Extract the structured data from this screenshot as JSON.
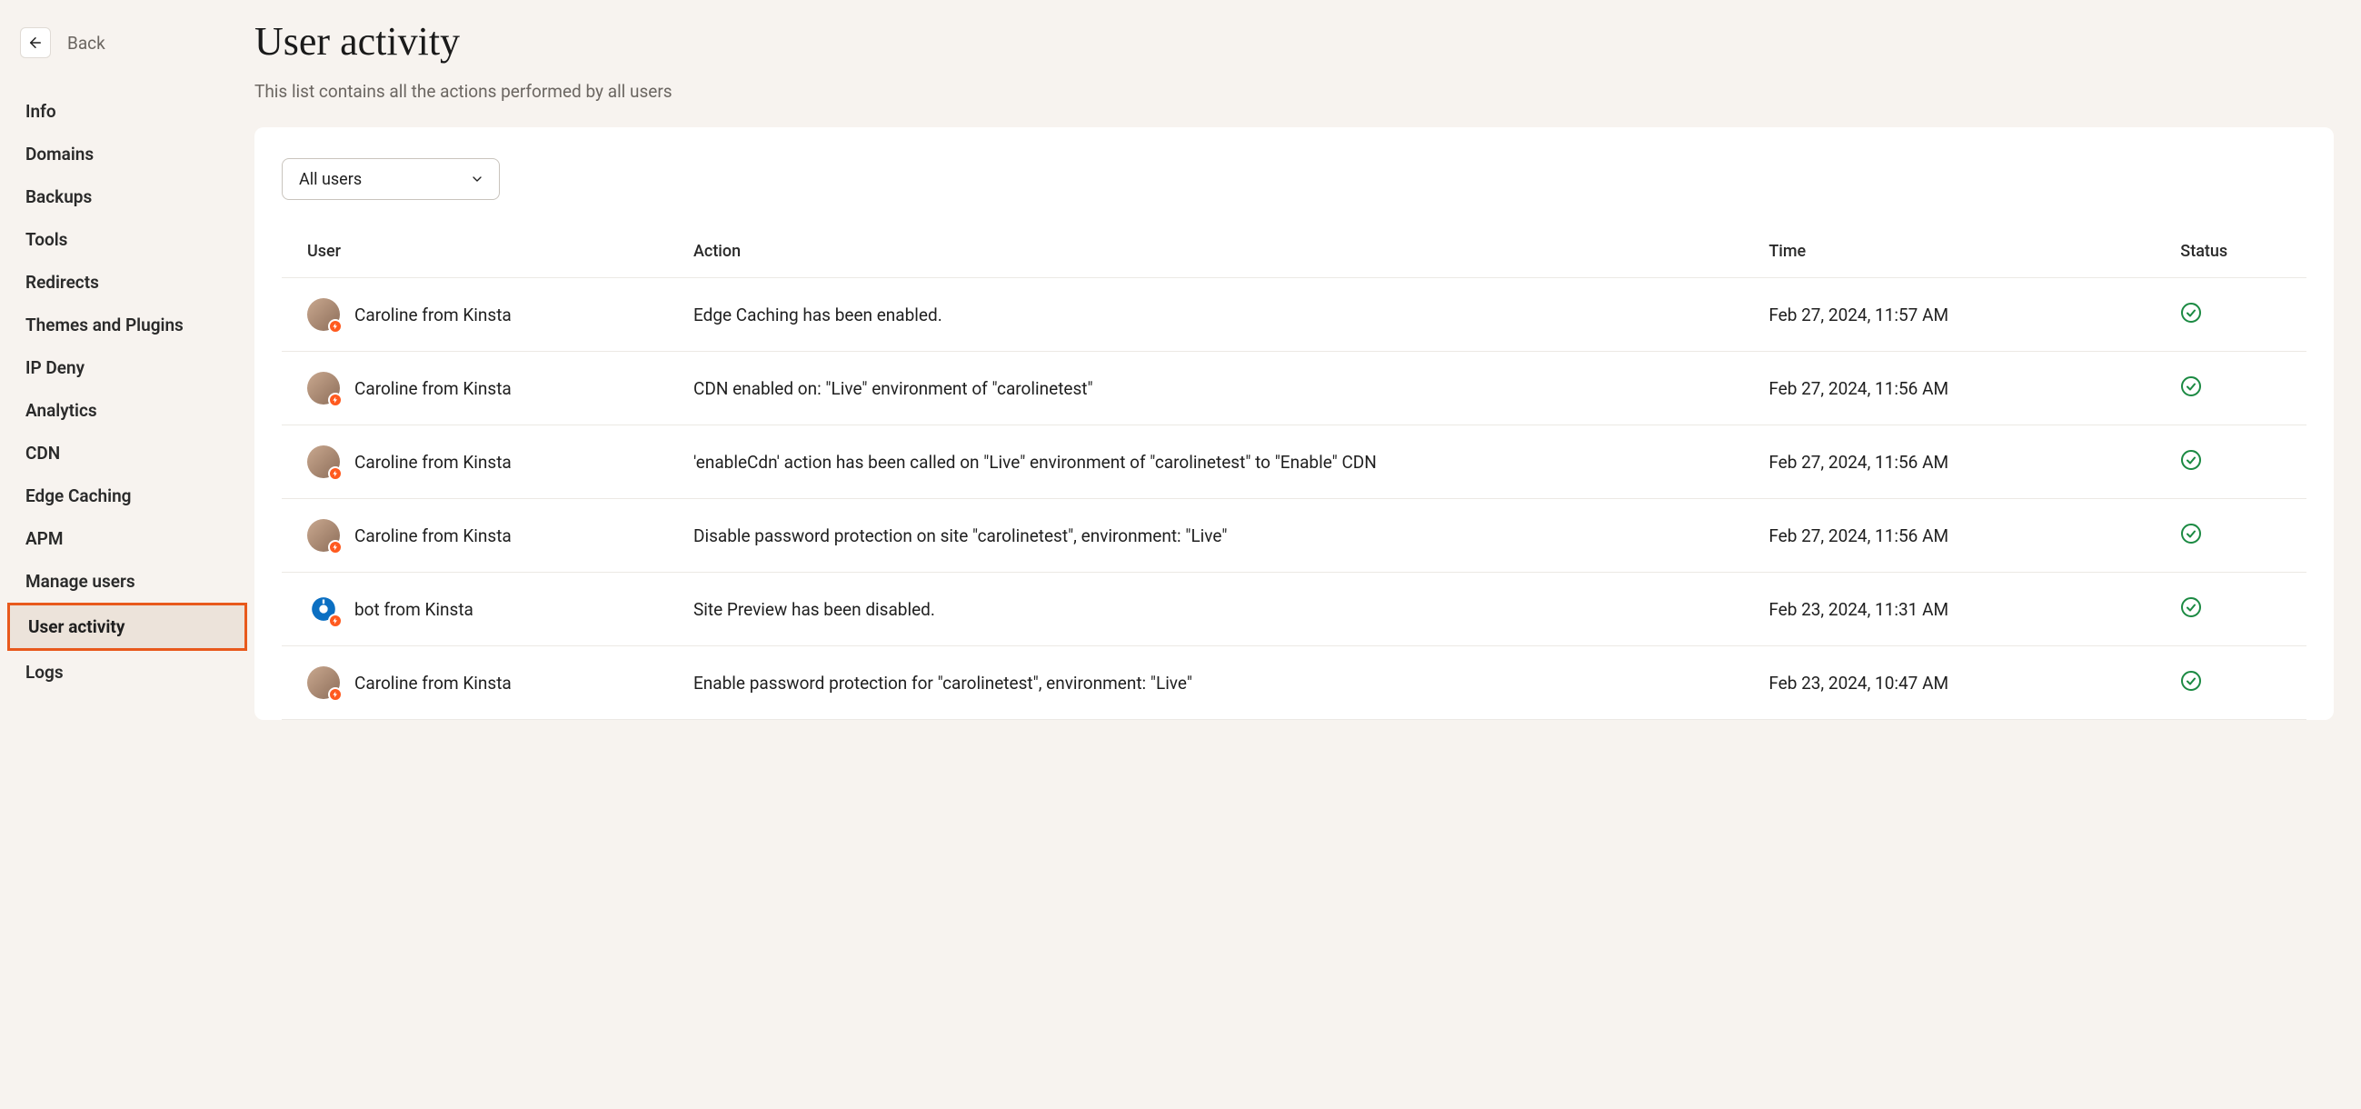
{
  "back_label": "Back",
  "sidebar": {
    "items": [
      "Info",
      "Domains",
      "Backups",
      "Tools",
      "Redirects",
      "Themes and Plugins",
      "IP Deny",
      "Analytics",
      "CDN",
      "Edge Caching",
      "APM",
      "Manage users",
      "User activity",
      "Logs"
    ],
    "active_index": 12
  },
  "page": {
    "title": "User activity",
    "subtitle": "This list contains all the actions performed by all users"
  },
  "filter": {
    "selected": "All users"
  },
  "table": {
    "headers": {
      "user": "User",
      "action": "Action",
      "time": "Time",
      "status": "Status"
    },
    "rows": [
      {
        "user": "Caroline from Kinsta",
        "avatar_type": "person",
        "action": "Edge Caching has been enabled.",
        "time": "Feb 27, 2024, 11:57 AM",
        "status": "success"
      },
      {
        "user": "Caroline from Kinsta",
        "avatar_type": "person",
        "action": "CDN enabled on: \"Live\" environment of \"carolinetest\"",
        "time": "Feb 27, 2024, 11:56 AM",
        "status": "success"
      },
      {
        "user": "Caroline from Kinsta",
        "avatar_type": "person",
        "action": "'enableCdn' action has been called on \"Live\" environment of \"carolinetest\" to \"Enable\" CDN",
        "time": "Feb 27, 2024, 11:56 AM",
        "status": "success"
      },
      {
        "user": "Caroline from Kinsta",
        "avatar_type": "person",
        "action": "Disable password protection on site \"carolinetest\", environment: \"Live\"",
        "time": "Feb 27, 2024, 11:56 AM",
        "status": "success"
      },
      {
        "user": "bot from Kinsta",
        "avatar_type": "bot",
        "action": "Site Preview has been disabled.",
        "time": "Feb 23, 2024, 11:31 AM",
        "status": "success"
      },
      {
        "user": "Caroline from Kinsta",
        "avatar_type": "person",
        "action": "Enable password protection for \"carolinetest\", environment: \"Live\"",
        "time": "Feb 23, 2024, 10:47 AM",
        "status": "success"
      }
    ]
  }
}
